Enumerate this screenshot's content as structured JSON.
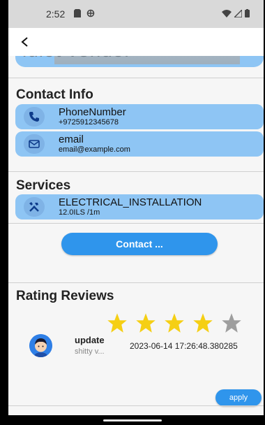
{
  "status_bar": {
    "time": "2:52"
  },
  "header": {
    "back_icon": "back-arrow-icon"
  },
  "banner": {
    "text": "idiot vendor"
  },
  "contact_info": {
    "title": "Contact Info",
    "items": [
      {
        "label": "PhoneNumber",
        "value": "+9725912345678",
        "icon": "phone-icon"
      },
      {
        "label": "email",
        "value": "email@example.com",
        "icon": "mail-icon"
      }
    ]
  },
  "services": {
    "title": "Services",
    "items": [
      {
        "label": "ELECTRICAL_INSTALLATION",
        "value": "12.0ILS /1m",
        "icon": "tools-icon"
      }
    ]
  },
  "contact_button": {
    "label": "Contact ..."
  },
  "reviews": {
    "title": "Rating Reviews",
    "rating": 4,
    "max_rating": 5,
    "review": {
      "title": "update",
      "snippet": "shitty v...",
      "date": "2023-06-14 17:26:48.380285"
    }
  },
  "apply_button": {
    "label": "apply"
  },
  "colors": {
    "card": "#8ec5f4",
    "accent": "#2f95ec",
    "star_on": "#f5cf14",
    "star_off": "#9e9e9e"
  }
}
